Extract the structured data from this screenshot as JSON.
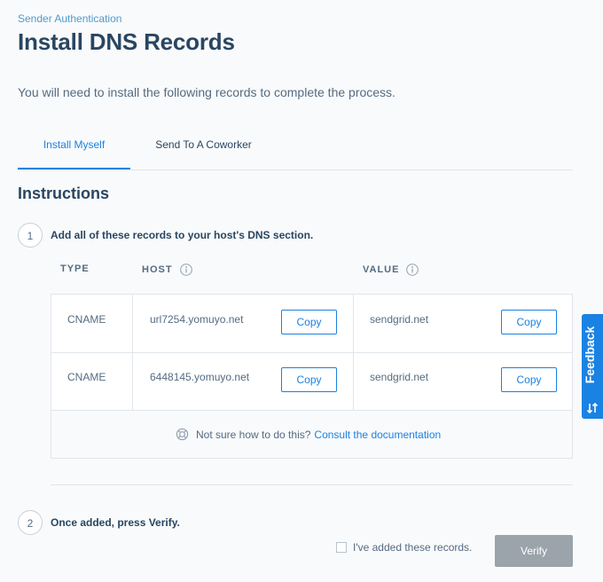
{
  "breadcrumb": "Sender Authentication",
  "title": "Install DNS Records",
  "intro": "You will need to install the following records to complete the process.",
  "tabs": [
    {
      "label": "Install Myself",
      "active": true
    },
    {
      "label": "Send To A Coworker",
      "active": false
    }
  ],
  "instructions_title": "Instructions",
  "steps": [
    {
      "number": "1",
      "text": "Add all of these records to your host's DNS section."
    },
    {
      "number": "2",
      "text": "Once added, press Verify."
    }
  ],
  "table": {
    "headers": {
      "type": "TYPE",
      "host": "HOST",
      "value": "VALUE"
    },
    "rows": [
      {
        "type": "CNAME",
        "host": "url7254.yomuyo.net",
        "value": "sendgrid.net"
      },
      {
        "type": "CNAME",
        "host": "6448145.yomuyo.net",
        "value": "sendgrid.net"
      }
    ],
    "copy_label": "Copy"
  },
  "help": {
    "text": "Not sure how to do this?",
    "link": "Consult the documentation"
  },
  "checkbox_label": "I've added these records.",
  "verify_label": "Verify",
  "feedback_label": "Feedback",
  "icons": {
    "info": "info-icon",
    "help": "lifebuoy-icon",
    "feedback": "sort-arrows-icon"
  },
  "colors": {
    "primary": "#1a82e2",
    "heading": "#294661",
    "muted_text": "#546b81",
    "verify_disabled": "#9ba3ab"
  }
}
